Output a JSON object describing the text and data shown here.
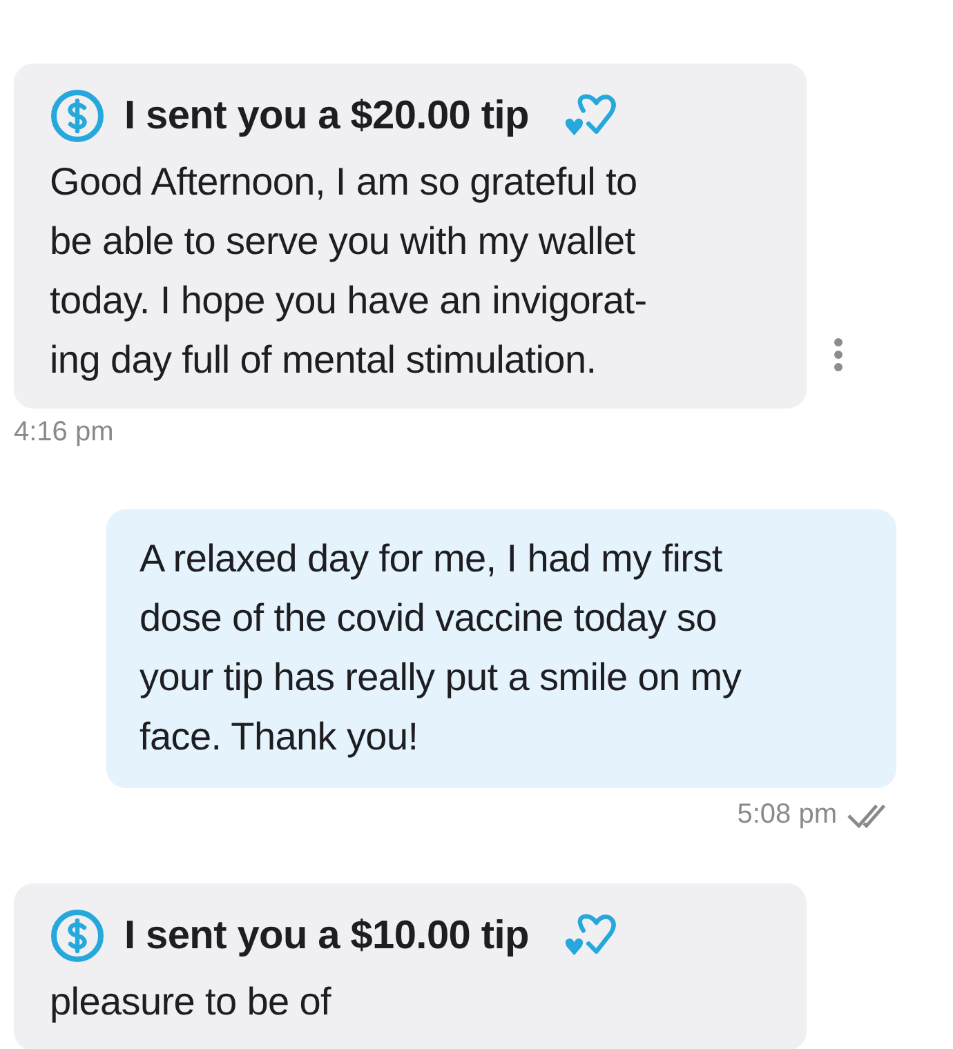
{
  "messages": [
    {
      "kind": "tip",
      "title": "I sent you a $20.00 tip",
      "body": "Good Afternoon, I am so grateful to\nbe able to serve you with my wallet\ntoday. I hope you have an invigorat-\ning day full of mental stimulation.",
      "time": "4:16 pm",
      "menu": true
    },
    {
      "kind": "sent",
      "body": "A relaxed day for me, I had my first\ndose of the covid vaccine today so\nyour tip has really put a smile on my\nface. Thank you!",
      "time": "5:08 pm",
      "read": true
    },
    {
      "kind": "tip",
      "title": "I sent you a $10.00 tip",
      "body": "pleasure to be of",
      "menu": false
    }
  ]
}
